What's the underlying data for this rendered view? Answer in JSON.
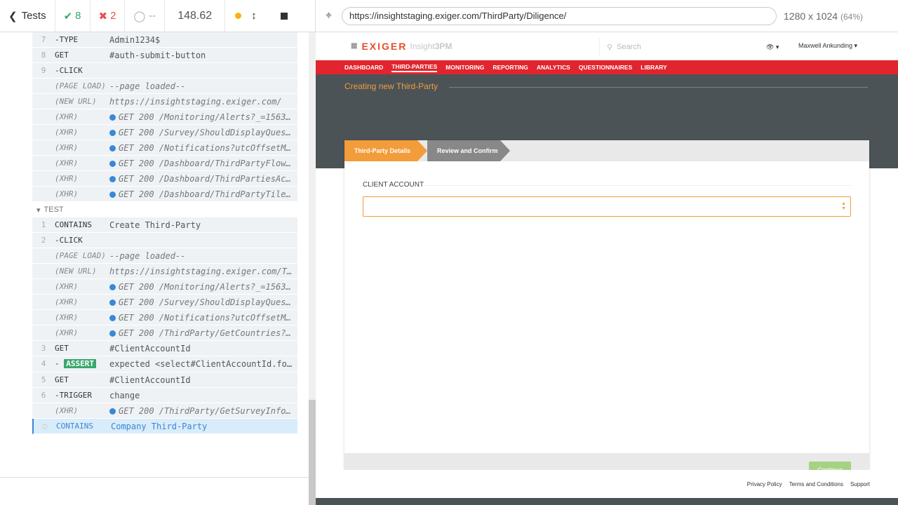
{
  "runner": {
    "tests_label": "Tests",
    "passed": "8",
    "failed": "2",
    "pending": "--",
    "duration": "148.62",
    "url": "https://insightstaging.exiger.com/ThirdParty/Diligence/",
    "viewport": "1280 x 1024",
    "scale": "(64%)"
  },
  "commands_before": [
    {
      "num": "7",
      "name": "-TYPE",
      "msg": "Admin1234$"
    },
    {
      "num": "8",
      "name": "GET",
      "msg": "#auth-submit-button"
    },
    {
      "num": "9",
      "name": "-CLICK",
      "msg": ""
    },
    {
      "num": "",
      "name": "(PAGE LOAD)",
      "msg": "--page loaded--",
      "italic": true
    },
    {
      "num": "",
      "name": "(NEW URL)",
      "msg": "https://insightstaging.exiger.com/",
      "italic": true
    },
    {
      "num": "",
      "name": "(XHR)",
      "msg": "GET 200 /Monitoring/Alerts?_=1563…",
      "xhr": true
    },
    {
      "num": "",
      "name": "(XHR)",
      "msg": "GET 200 /Survey/ShouldDisplayQues…",
      "xhr": true
    },
    {
      "num": "",
      "name": "(XHR)",
      "msg": "GET 200 /Notifications?utcOffsetM…",
      "xhr": true
    },
    {
      "num": "",
      "name": "(XHR)",
      "msg": "GET 200 /Dashboard/ThirdPartyFlow…",
      "xhr": true
    },
    {
      "num": "",
      "name": "(XHR)",
      "msg": "GET 200 /Dashboard/ThirdPartiesAc…",
      "xhr": true
    },
    {
      "num": "",
      "name": "(XHR)",
      "msg": "GET 200 /Dashboard/ThirdPartyTile…",
      "xhr": true
    }
  ],
  "test_header": "TEST",
  "commands_test": [
    {
      "num": "1",
      "name": "CONTAINS",
      "msg": "Create Third-Party"
    },
    {
      "num": "2",
      "name": "-CLICK",
      "msg": ""
    },
    {
      "num": "",
      "name": "(PAGE LOAD)",
      "msg": "--page loaded--",
      "italic": true
    },
    {
      "num": "",
      "name": "(NEW URL)",
      "msg": "https://insightstaging.exiger.com/T…",
      "italic": true
    },
    {
      "num": "",
      "name": "(XHR)",
      "msg": "GET 200 /Monitoring/Alerts?_=1563…",
      "xhr": true
    },
    {
      "num": "",
      "name": "(XHR)",
      "msg": "GET 200 /Survey/ShouldDisplayQues…",
      "xhr": true
    },
    {
      "num": "",
      "name": "(XHR)",
      "msg": "GET 200 /Notifications?utcOffsetM…",
      "xhr": true
    },
    {
      "num": "",
      "name": "(XHR)",
      "msg": "GET 200 /ThirdParty/GetCountries?…",
      "xhr": true
    },
    {
      "num": "3",
      "name": "GET",
      "msg": "#ClientAccountId"
    }
  ],
  "assert_cmd": {
    "num": "4",
    "name": "ASSERT",
    "msg": "expected <select#ClientAccountId.form-control.vital-dropdown> to be visible"
  },
  "commands_after": [
    {
      "num": "5",
      "name": "GET",
      "msg": "#ClientAccountId"
    },
    {
      "num": "6",
      "name": "-TRIGGER",
      "msg": "change"
    },
    {
      "num": "",
      "name": "(XHR)",
      "msg": "GET 200 /ThirdParty/GetSurveyInfo…",
      "xhr": true
    }
  ],
  "active_cmd": {
    "name": "CONTAINS",
    "msg": "Company Third-Party"
  },
  "app": {
    "logo": "EXIGER",
    "logo_sub": "Insight",
    "logo_sub2": "3PM",
    "search_placeholder": "Search",
    "user": "Maxwell Ankunding",
    "nav": [
      "DASHBOARD",
      "THIRD-PARTIES",
      "MONITORING",
      "REPORTING",
      "ANALYTICS",
      "QUESTIONNAIRES",
      "LIBRARY"
    ],
    "page_title": "Creating new Third-Party",
    "step1": "Third-Party Details",
    "step2": "Review and Confirm",
    "field_label": "CLIENT ACCOUNT",
    "continue": "Continue",
    "footer": [
      "Privacy Policy",
      "Terms and Conditions",
      "Support"
    ]
  }
}
